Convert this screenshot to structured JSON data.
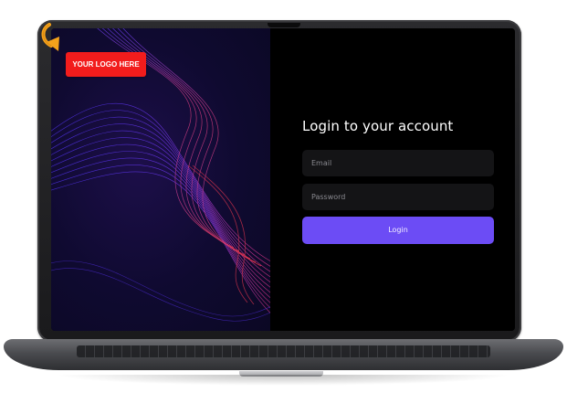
{
  "logo": {
    "text": "YOUR LOGO HERE",
    "color": "#f21c1c"
  },
  "decor": {
    "arrow_icon": "curved-arrow-icon",
    "arrow_color": "#f5a21b"
  },
  "login": {
    "title": "Login to your account",
    "email_placeholder": "Email",
    "password_placeholder": "Password",
    "button_label": "Login",
    "accent_color": "#6c4cf5"
  }
}
